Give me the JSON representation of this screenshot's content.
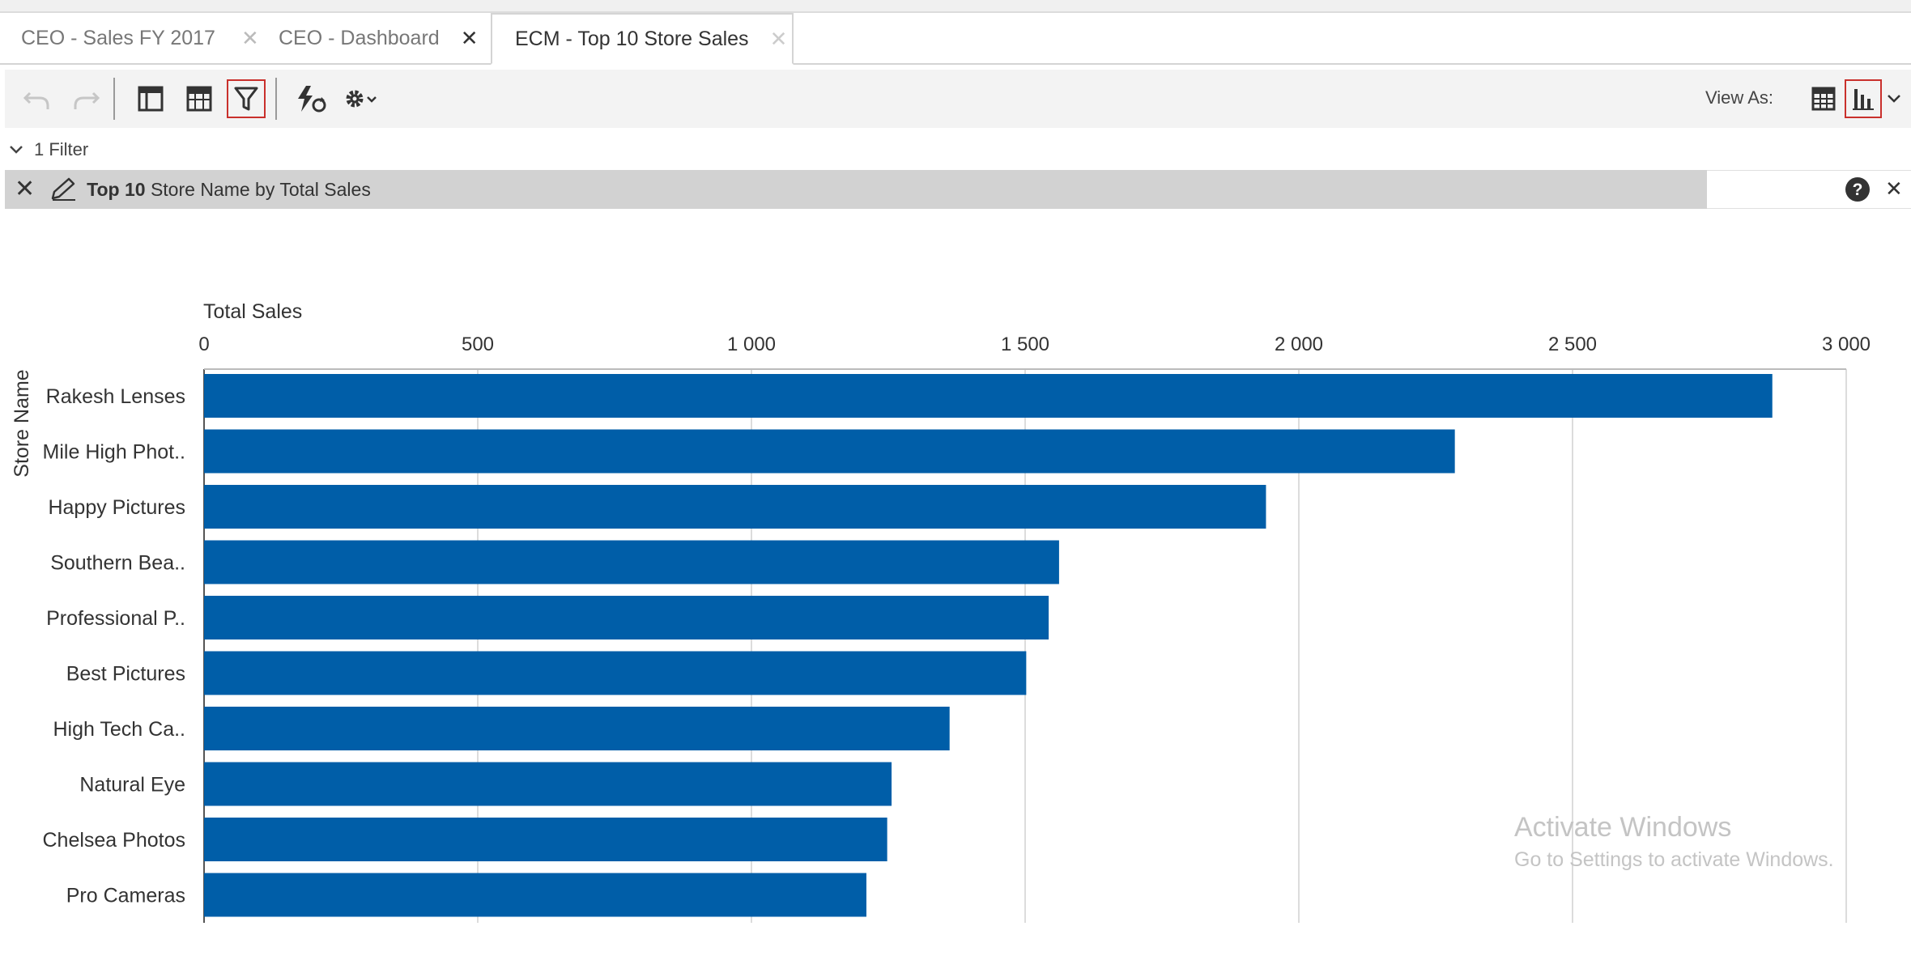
{
  "tabs": [
    {
      "label": "CEO - Sales FY 2017",
      "active": false
    },
    {
      "label": "CEO - Dashboard",
      "active": false
    },
    {
      "label": "ECM - Top 10 Store Sales",
      "active": true
    }
  ],
  "toolbar": {
    "view_as_label": "View As:",
    "icons": [
      "undo-icon",
      "redo-icon",
      "layout-icon",
      "table-layout-icon",
      "filter-icon",
      "refresh-icon",
      "settings-icon",
      "table-view-icon",
      "chart-view-icon",
      "chevron-down-icon"
    ]
  },
  "filters": {
    "toggle_label": "1 Filter",
    "filter_bold": "Top 10",
    "filter_text": " Store Name by Total Sales"
  },
  "colors": {
    "bar": "#005ea8",
    "selected_border": "#c9302c",
    "filterbar_bg": "#d2d2d2"
  },
  "chart_data": {
    "type": "bar",
    "orientation": "horizontal",
    "xlabel": "Total Sales",
    "ylabel": "Store Name",
    "xlim": [
      0,
      3000
    ],
    "ticks": [
      0,
      500,
      1000,
      1500,
      2000,
      2500,
      3000
    ],
    "tick_labels": [
      "0",
      "500",
      "1 000",
      "1 500",
      "2 000",
      "2 500",
      "3 000"
    ],
    "grid": true,
    "categories": [
      "Rakesh Lenses",
      "Mile High Phot..",
      "Happy Pictures",
      "Southern Bea..",
      "Professional P..",
      "Best Pictures",
      "High Tech Ca..",
      "Natural Eye",
      "Chelsea Photos",
      "Pro Cameras"
    ],
    "values": [
      2865,
      2285,
      1940,
      1562,
      1543,
      1502,
      1362,
      1256,
      1248,
      1210
    ]
  },
  "watermark": {
    "line1": "Activate Windows",
    "line2": "Go to Settings to activate Windows."
  }
}
